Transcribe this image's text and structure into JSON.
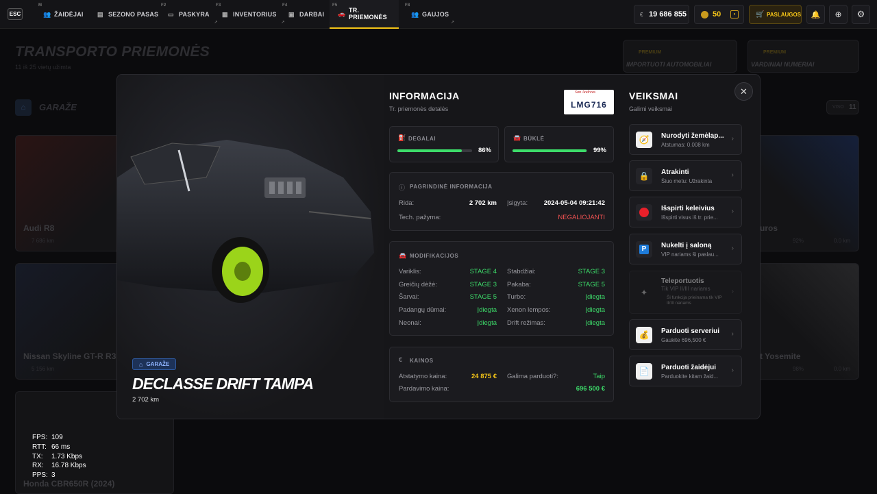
{
  "topbar": {
    "esc": "ESC",
    "tabs": [
      {
        "key": "M",
        "label": "ŽAIDĖJAI",
        "icon": "users-icon"
      },
      {
        "key": "",
        "label": "SEZONO PASAS",
        "icon": "ticket-icon"
      },
      {
        "key": "F2",
        "label": "PASKYRA",
        "icon": "id-card-icon"
      },
      {
        "key": "F3",
        "label": "INVENTORIUS",
        "icon": "box-icon"
      },
      {
        "key": "F4",
        "label": "DARBAI",
        "icon": "briefcase-icon"
      },
      {
        "key": "F5",
        "label": "TR. PRIEMONĖS",
        "icon": "car-icon"
      },
      {
        "key": "F8",
        "label": "GAUJOS",
        "icon": "gang-icon"
      }
    ],
    "money": "19 686 855",
    "money_symbol": "€",
    "coins": "50",
    "shop_label": "PASLAUGOS"
  },
  "background": {
    "title": "TRANSPORTO PRIEMONĖS",
    "subtitle": "11 iš 25 vietų užimta",
    "premium1_tag": "PREMIUM",
    "premium1_title": "IMPORTUOTI AUTOMOBILIAI",
    "premium2_tag": "PREMIUM",
    "premium2_title": "VARDINIAI NUMERIAI",
    "garage_label": "GARAŽE",
    "count_label": "VISO",
    "count_value": "11",
    "cards": [
      {
        "name": "Audi R8",
        "km": "7 686 km"
      },
      {
        "name": "Nissan Skyline GT-R R3",
        "km": "5 156 km"
      },
      {
        "name": "Honda CBR650R (2024)",
        "km": ""
      },
      {
        "name": "uros",
        "km": "0.0 km",
        "pct": "92%"
      },
      {
        "name": "t Yosemite",
        "km": "0.0 km",
        "pct": "98%"
      }
    ]
  },
  "modal": {
    "badge": "GARAŽE",
    "car_name": "DECLASSE DRIFT TAMPA",
    "car_km": "2 702 km",
    "info_title": "INFORMACIJA",
    "info_sub": "Tr. priemonės detalės",
    "plate_state": "San Andreas",
    "plate": "LMG716",
    "fuel_label": "DEGALAI",
    "fuel_value": "86%",
    "fuel_pct": 86,
    "cond_label": "BŪKLĖ",
    "cond_value": "99%",
    "cond_pct": 99,
    "basic_title": "PAGRINDINĖ INFORMACIJA",
    "mileage_label": "Rida:",
    "mileage_value": "2 702 km",
    "bought_label": "Įsigyta:",
    "bought_value": "2024-05-04 09:21:42",
    "inspection_label": "Tech. pažyma:",
    "inspection_value": "NEGALIOJANTI",
    "mods_title": "MODIFIKACIJOS",
    "mods": [
      {
        "l": "Variklis:",
        "v": "STAGE 4",
        "l2": "Stabdžiai:",
        "v2": "STAGE 3"
      },
      {
        "l": "Greičių dėžė:",
        "v": "STAGE 3",
        "l2": "Pakaba:",
        "v2": "STAGE 5"
      },
      {
        "l": "Šarvai:",
        "v": "STAGE 5",
        "l2": "Turbo:",
        "v2": "Įdiegta"
      },
      {
        "l": "Padangų dūmai:",
        "v": "Įdiegta",
        "l2": "Xenon lempos:",
        "v2": "Įdiegta"
      },
      {
        "l": "Neonai:",
        "v": "Įdiegta",
        "l2": "Drift režimas:",
        "v2": "Įdiegta"
      }
    ],
    "prices_title": "KAINOS",
    "restore_label": "Atstatymo kaina:",
    "restore_value": "24 875 €",
    "sellable_label": "Galima parduoti?:",
    "sellable_value": "Taip",
    "sell_label": "Pardavimo kaina:",
    "sell_value": "696 500 €",
    "actions_title": "VEIKSMAI",
    "actions_sub": "Galimi veiksmai",
    "actions": [
      {
        "t": "Nurodyti žemėlap...",
        "s": "Atstumas: 0.008 km"
      },
      {
        "t": "Atrakinti",
        "s": "Šiuo metu: Užrakinta"
      },
      {
        "t": "Išspirti keleivius",
        "s": "Išspirti visus iš tr. prie..."
      },
      {
        "t": "Nukelti į saloną",
        "s": "VIP nariams ši paslau..."
      },
      {
        "t": "Teleportuotis",
        "s": "Tik VIP II/III nariams",
        "note": "Ši funkcija prieinama tik VIP II/III nariams"
      },
      {
        "t": "Parduoti serveriui",
        "s": "Gaukite 696,500 €"
      },
      {
        "t": "Parduoti žaidėjui",
        "s": "Parduokite kitam žaid..."
      }
    ]
  },
  "debug": {
    "fps_l": "FPS:",
    "fps": "109",
    "rtt_l": "RTT:",
    "rtt": "66 ms",
    "tx_l": "TX:",
    "tx": "1.73 Kbps",
    "rx_l": "RX:",
    "rx": "16.78 Kbps",
    "pps_l": "PPS:",
    "pps": "3"
  }
}
